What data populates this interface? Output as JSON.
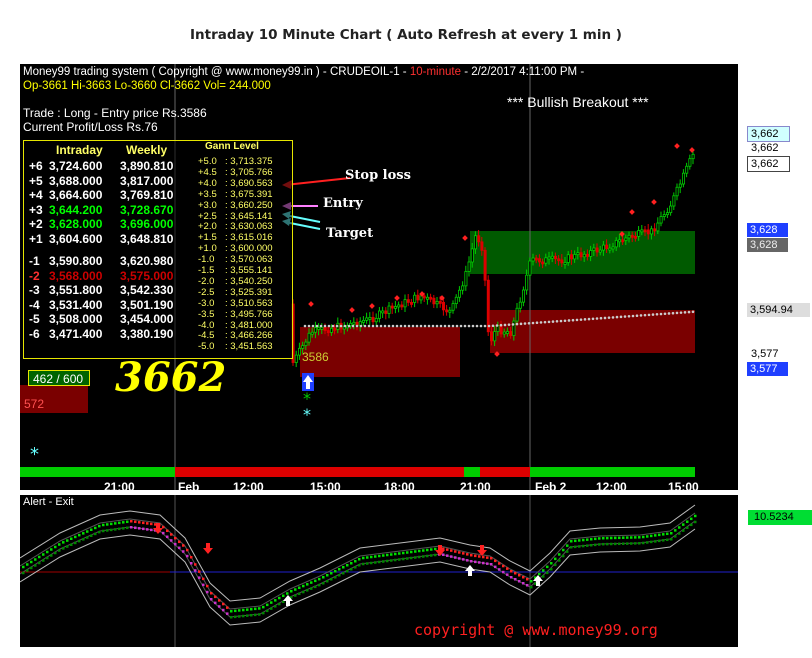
{
  "page_title": "Intraday 10 Minute Chart ( Auto Refresh at every 1 min )",
  "header": {
    "line1_system": "Money99 trading system ( Copyright @ www.money99.in ) - CRUDEOIL-1 -",
    "line1_interval": "10-minute",
    "line1_datetime": "- 2/2/2017 4:11:00 PM -",
    "line2_ohlc": "Op-3661  Hi-3663  Lo-3660  Cl-3662  Vol=  244.000",
    "trade": "Trade : Long - Entry price Rs.3586",
    "profit_loss": "Current Profit/Loss Rs.76",
    "breakout": "*** Bullish Breakout ***"
  },
  "gann_table": {
    "headers": {
      "intraday": "Intraday",
      "weekly": "Weekly",
      "gann": "Gann Level"
    },
    "rows": [
      {
        "level": "+6",
        "intraday": "3,724.600",
        "weekly": "3,890.810"
      },
      {
        "level": "+5",
        "intraday": "3,688.000",
        "weekly": "3,817.000"
      },
      {
        "level": "+4",
        "intraday": "3,664.600",
        "weekly": "3,769.810"
      },
      {
        "level": "+3",
        "intraday": "3,644.200",
        "weekly": "3,728.670"
      },
      {
        "level": "+2",
        "intraday": "3,628.000",
        "weekly": "3,696.000"
      },
      {
        "level": "+1",
        "intraday": "3,604.600",
        "weekly": "3,648.810"
      },
      {
        "level": "-1",
        "intraday": "3,590.800",
        "weekly": "3,620.980"
      },
      {
        "level": "-2",
        "intraday": "3,568.000",
        "weekly": "3,575.000"
      },
      {
        "level": "-3",
        "intraday": "3,551.800",
        "weekly": "3,542.330"
      },
      {
        "level": "-4",
        "intraday": "3,531.400",
        "weekly": "3,501.190"
      },
      {
        "level": "-5",
        "intraday": "3,508.000",
        "weekly": "3,454.000"
      },
      {
        "level": "-6",
        "intraday": "3,471.400",
        "weekly": "3,380.190"
      }
    ],
    "gann_levels": [
      {
        "l": "+5.0",
        "v": ": 3,713.375"
      },
      {
        "l": "+4.5",
        "v": ": 3,705.766"
      },
      {
        "l": "+4.0",
        "v": ": 3,690.563"
      },
      {
        "l": "+3.5",
        "v": ": 3,675.391"
      },
      {
        "l": "+3.0",
        "v": ": 3,660.250"
      },
      {
        "l": "+2.5",
        "v": ": 3,645.141"
      },
      {
        "l": "+2.0",
        "v": ": 3,630.063"
      },
      {
        "l": "+1.5",
        "v": ": 3,615.016"
      },
      {
        "l": "+1.0",
        "v": ": 3,600.000"
      },
      {
        "l": "-1.0",
        "v": ": 3,570.063"
      },
      {
        "l": "-1.5",
        "v": ": 3,555.141"
      },
      {
        "l": "-2.0",
        "v": ": 3,540.250"
      },
      {
        "l": "-2.5",
        "v": ": 3,525.391"
      },
      {
        "l": "-3.0",
        "v": ": 3,510.563"
      },
      {
        "l": "-3.5",
        "v": ": 3,495.766"
      },
      {
        "l": "-4.0",
        "v": ": 3,481.000"
      },
      {
        "l": "-4.5",
        "v": ": 3,466.266"
      },
      {
        "l": "-5.0",
        "v": ": 3,451.563"
      }
    ]
  },
  "annotations": {
    "stop_loss": "Stop loss",
    "entry": "Entry",
    "target": "Target"
  },
  "counter_label": "462 / 600",
  "big_price": "3662",
  "band_label": "3586",
  "left_tag": "572",
  "price_tags": {
    "current": "3,662",
    "current_plain": "3,662",
    "current_box": "3,662",
    "upper_blue": "3,628",
    "upper_gray": "3,628",
    "mid": "3,594.94",
    "lower_plain": "3,577",
    "lower_blue": "3,577"
  },
  "time_axis": [
    "21:00",
    "Feb",
    "12:00",
    "15:00",
    "18:00",
    "21:00",
    "Feb 2",
    "12:00",
    "15:00"
  ],
  "oscillator": {
    "title": "Alert - Exit",
    "value": "10.5234"
  },
  "copyright": "copyright @ www.money99.org",
  "colors": {
    "background": "#000000",
    "bullish": "#00cc00",
    "bearish": "#cc0000",
    "green_band": "#006400",
    "red_band": "#7a0000",
    "gann_text": "#ffff66"
  }
}
